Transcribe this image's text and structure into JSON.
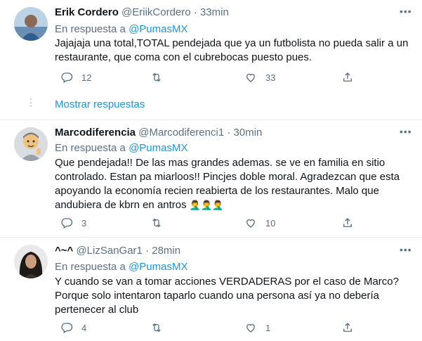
{
  "tweets": [
    {
      "name": "Erik Cordero",
      "handle": "@EriikCordero",
      "time": "33min",
      "reply_prefix": "En respuesta a",
      "reply_to": "@PumasMX",
      "text": "Jajajaja una total,TOTAL pendejada que ya un futbolista no pueda salir a un restaurante, que coma con el cubrebocas puesto pues.",
      "replies": "12",
      "retweets": "",
      "likes": "33"
    },
    {
      "name": "Marcodiferencia",
      "handle": "@Marcodiferenci1",
      "time": "30min",
      "reply_prefix": "En respuesta a",
      "reply_to": "@PumasMX",
      "text": "Que pendejada!! De las mas grandes ademas. se ve en familia en sitio controlado. Estan pa miarloos!! Pincjes doble moral. Agradezcan que esta apoyando la economía recien reabierta de los restaurantes. Malo que andubiera de kbrn en antros",
      "replies": "3",
      "retweets": "",
      "likes": "10"
    },
    {
      "name": "^~^",
      "handle": "@LizSanGar1",
      "time": "28min",
      "reply_prefix": "En respuesta a",
      "reply_to": "@PumasMX",
      "text": "Y cuando se van a tomar acciones VERDADERAS por el caso de Marco? Porque solo intentaron taparlo cuando una persona así ya no debería pertenecer al club",
      "replies": "4",
      "retweets": "",
      "likes": "1"
    }
  ],
  "show_more": "Mostrar respuestas",
  "separator": " · ",
  "more_glyph": "•••",
  "colors": {
    "accent": "#1b95e0",
    "muted": "#5b7083",
    "text": "#0f1419"
  }
}
